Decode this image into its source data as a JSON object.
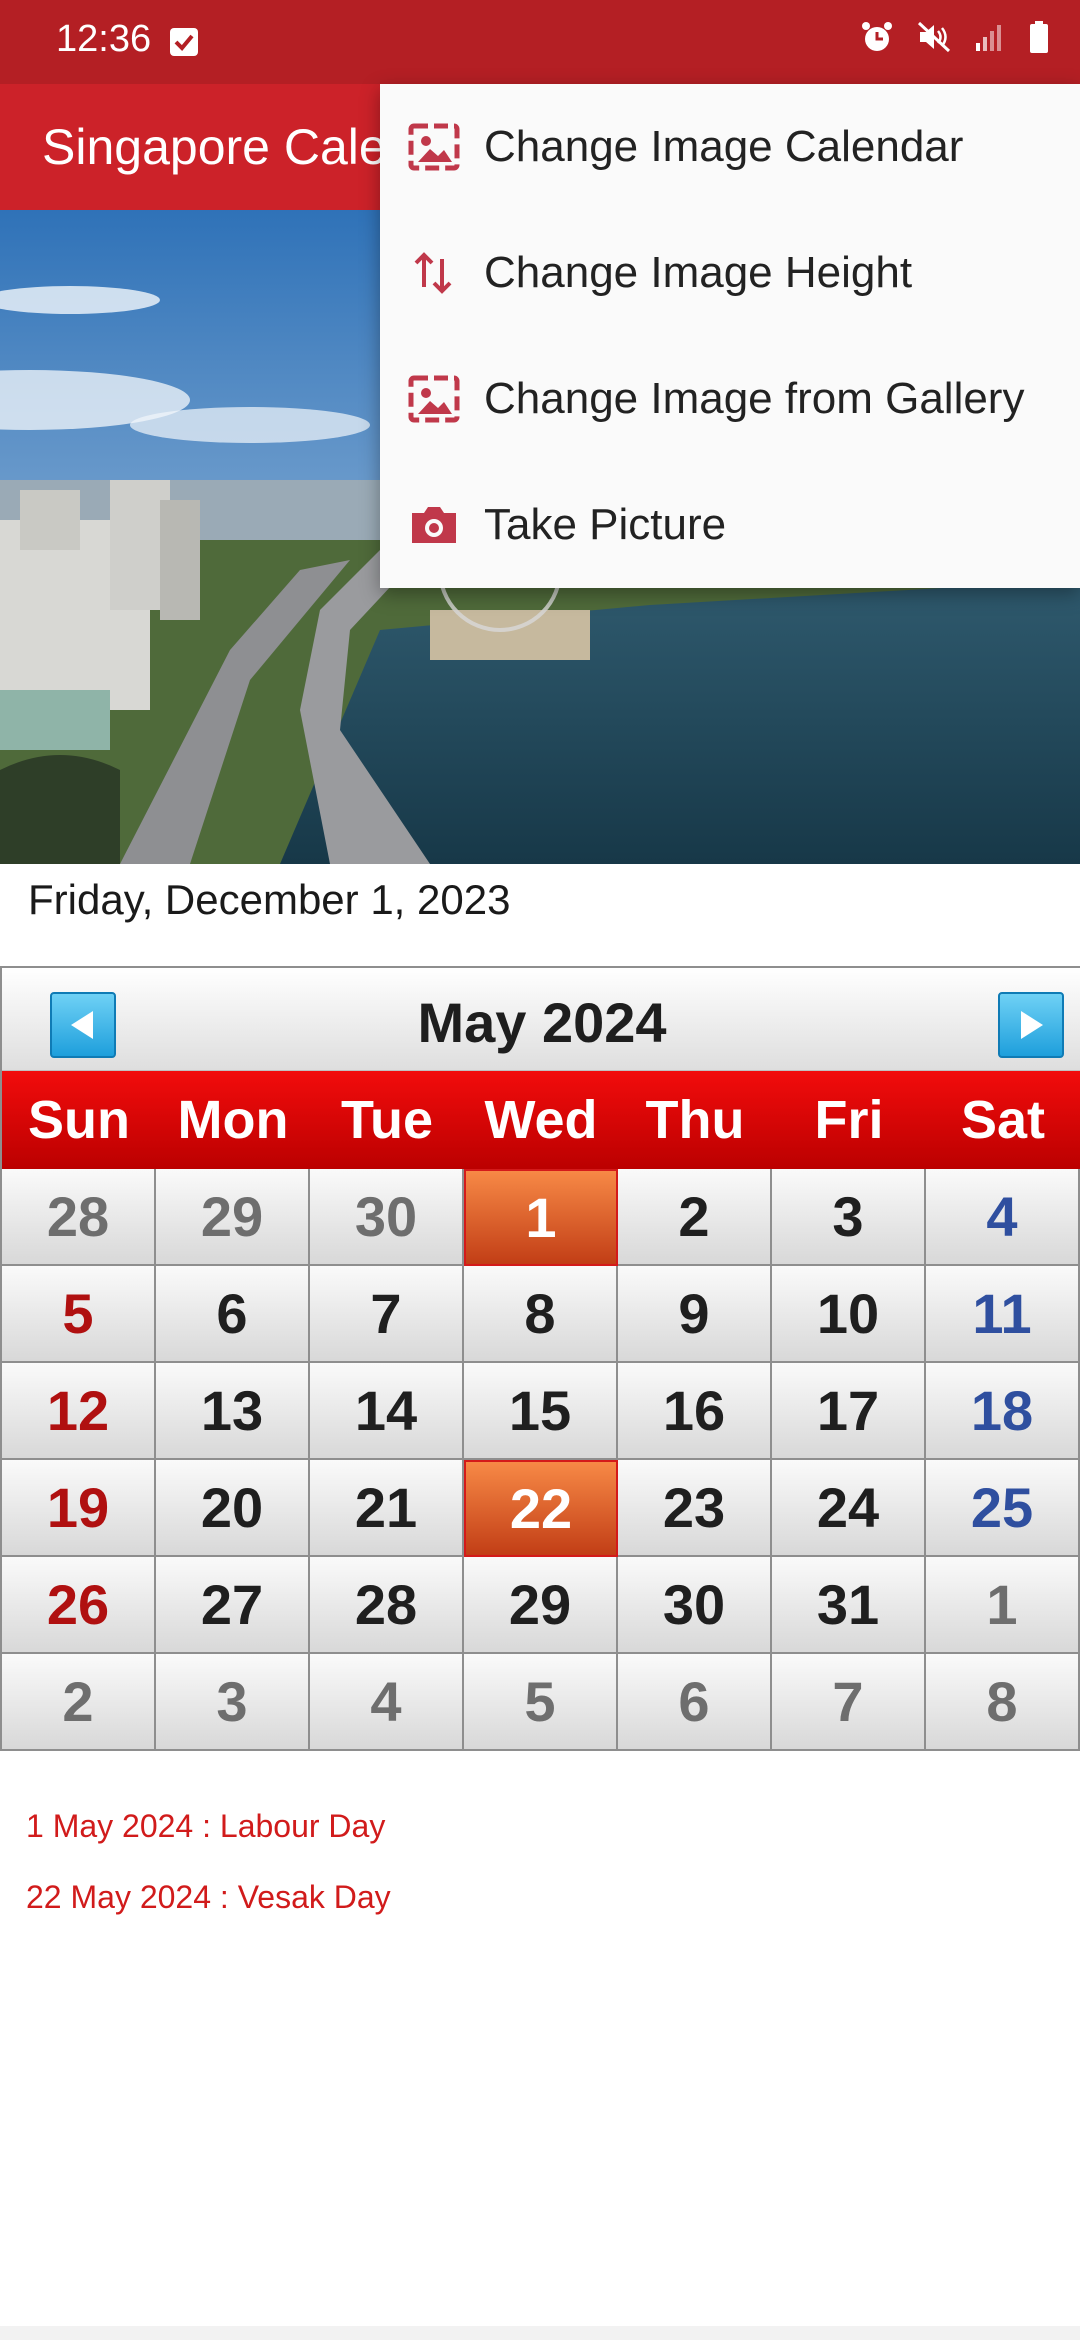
{
  "status_bar": {
    "time": "12:36",
    "icons": [
      "check-notification-icon",
      "alarm-icon",
      "mute-icon",
      "signal-icon",
      "battery-icon"
    ]
  },
  "app_bar": {
    "title": "Singapore Calendar"
  },
  "hero": {
    "description_icon": "singapore-photo"
  },
  "selected_date": "Friday, December 1, 2023",
  "calendar": {
    "month_title": "May  2024",
    "weekdays": [
      "Sun",
      "Mon",
      "Tue",
      "Wed",
      "Thu",
      "Fri",
      "Sat"
    ],
    "days": [
      {
        "t": "28",
        "k": "muted"
      },
      {
        "t": "29",
        "k": "muted"
      },
      {
        "t": "30",
        "k": "muted"
      },
      {
        "t": "1",
        "k": "holiday"
      },
      {
        "t": "2",
        "k": ""
      },
      {
        "t": "3",
        "k": ""
      },
      {
        "t": "4",
        "k": "sat"
      },
      {
        "t": "5",
        "k": "sun"
      },
      {
        "t": "6",
        "k": ""
      },
      {
        "t": "7",
        "k": ""
      },
      {
        "t": "8",
        "k": ""
      },
      {
        "t": "9",
        "k": ""
      },
      {
        "t": "10",
        "k": ""
      },
      {
        "t": "11",
        "k": "sat"
      },
      {
        "t": "12",
        "k": "sun"
      },
      {
        "t": "13",
        "k": ""
      },
      {
        "t": "14",
        "k": ""
      },
      {
        "t": "15",
        "k": ""
      },
      {
        "t": "16",
        "k": ""
      },
      {
        "t": "17",
        "k": ""
      },
      {
        "t": "18",
        "k": "sat"
      },
      {
        "t": "19",
        "k": "sun"
      },
      {
        "t": "20",
        "k": ""
      },
      {
        "t": "21",
        "k": ""
      },
      {
        "t": "22",
        "k": "holiday"
      },
      {
        "t": "23",
        "k": ""
      },
      {
        "t": "24",
        "k": ""
      },
      {
        "t": "25",
        "k": "sat"
      },
      {
        "t": "26",
        "k": "sun"
      },
      {
        "t": "27",
        "k": ""
      },
      {
        "t": "28",
        "k": ""
      },
      {
        "t": "29",
        "k": ""
      },
      {
        "t": "30",
        "k": ""
      },
      {
        "t": "31",
        "k": ""
      },
      {
        "t": "1",
        "k": "muted"
      },
      {
        "t": "2",
        "k": "muted"
      },
      {
        "t": "3",
        "k": "muted"
      },
      {
        "t": "4",
        "k": "muted"
      },
      {
        "t": "5",
        "k": "muted"
      },
      {
        "t": "6",
        "k": "muted"
      },
      {
        "t": "7",
        "k": "muted"
      },
      {
        "t": "8",
        "k": "muted"
      }
    ]
  },
  "holidays": [
    "1 May 2024 : Labour Day",
    "22 May 2024 : Vesak Day"
  ],
  "menu": {
    "items": [
      {
        "label": "Change Image Calendar",
        "icon": "image-icon"
      },
      {
        "label": "Change Image Height",
        "icon": "swap-vertical-icon"
      },
      {
        "label": "Change Image from Gallery",
        "icon": "image-icon"
      },
      {
        "label": "Take Picture",
        "icon": "camera-icon"
      }
    ]
  },
  "colors": {
    "status_bar": "#b41f24",
    "app_bar": "#cc2229",
    "weekday_header": "#e00a0a",
    "holiday_cell": "#e25b27",
    "holiday_text": "#d11b1b",
    "menu_icon": "#c0384a"
  }
}
